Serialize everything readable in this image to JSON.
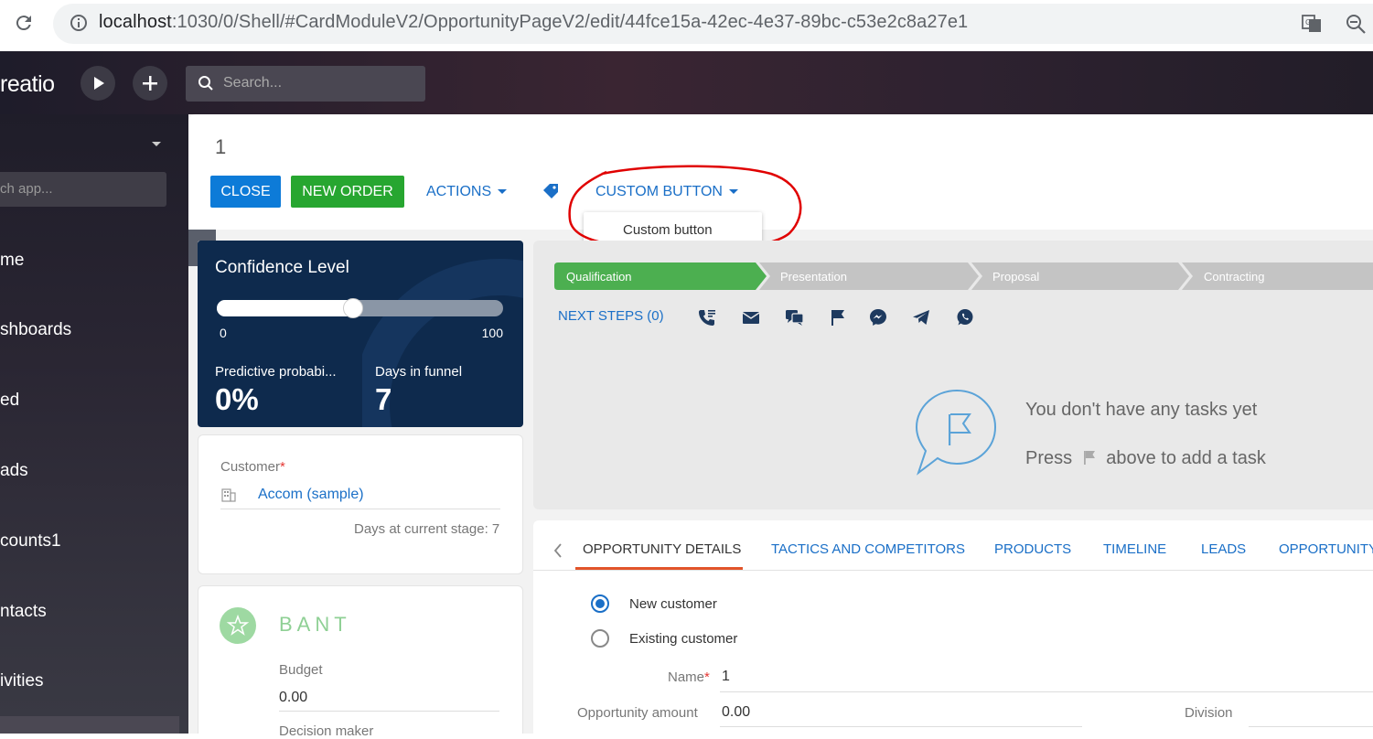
{
  "browser": {
    "url_host": "localhost",
    "url_rest": ":1030/0/Shell/#CardModuleV2/OpportunityPageV2/edit/44fce15a-42ec-4e37-89bc-c53e2c8a27e1",
    "icons": [
      "reload-icon",
      "info-icon",
      "translate-icon",
      "zoom-icon"
    ]
  },
  "header": {
    "logo": "reatio",
    "search_placeholder": "Search..."
  },
  "sidebar": {
    "search_placeholder": "ch app...",
    "items": [
      {
        "label": "me"
      },
      {
        "label": "shboards"
      },
      {
        "label": "ed"
      },
      {
        "label": "ads"
      },
      {
        "label": "counts1"
      },
      {
        "label": "ntacts"
      },
      {
        "label": "ivities"
      }
    ]
  },
  "record": {
    "title": "1"
  },
  "toolbar": {
    "close_label": "CLOSE",
    "new_order_label": "NEW ORDER",
    "actions_label": "ACTIONS",
    "custom_button_label": "CUSTOM BUTTON",
    "dropdown_item": "Custom button"
  },
  "confidence": {
    "title": "Confidence Level",
    "level": 0.45,
    "min": "0",
    "max": "100",
    "predictive_label": "Predictive probabi...",
    "predictive_value": "0%",
    "days_label": "Days in funnel",
    "days_value": "7"
  },
  "customer": {
    "label": "Customer",
    "required_mark": "*",
    "value": "Accom (sample)",
    "days_at_stage": "Days at current stage:  7"
  },
  "bant": {
    "title": "BANT",
    "budget_label": "Budget",
    "budget_value": "0.00",
    "decision_maker_label": "Decision maker"
  },
  "stages": [
    "Qualification",
    "Presentation",
    "Proposal",
    "Contracting"
  ],
  "next_steps": {
    "label": "NEXT STEPS (0)",
    "empty_line1": "You don't have any tasks yet",
    "empty_line2_a": "Press",
    "empty_line2_b": "above to add a task"
  },
  "tabs": [
    "OPPORTUNITY DETAILS",
    "TACTICS AND COMPETITORS",
    "PRODUCTS",
    "TIMELINE",
    "LEADS",
    "OPPORTUNITY"
  ],
  "details": {
    "new_customer": "New customer",
    "existing_customer": "Existing customer",
    "name_label": "Name",
    "name_req": "*",
    "name_value": "1",
    "amount_label": "Opportunity amount",
    "amount_value": "0.00",
    "division_label": "Division"
  },
  "colors": {
    "primary": "#0d7bd8",
    "success": "#27a630",
    "link": "#1a6fc7",
    "stage_active": "#4caf50",
    "stage_inactive": "#c4c4c4",
    "confidence_bg": "#0e2a4d",
    "annotation_red": "#e00000"
  }
}
